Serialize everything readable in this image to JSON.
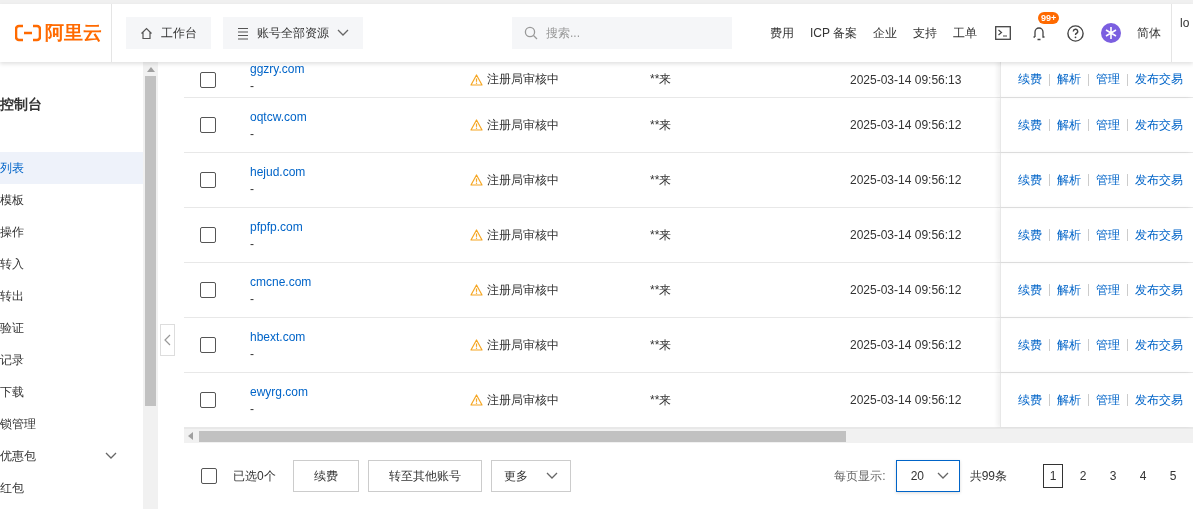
{
  "header": {
    "logo": "阿里云",
    "quick_buttons": [
      {
        "label": "工作台",
        "kind": "link"
      },
      {
        "label": "账号全部资源",
        "kind": "dropdown"
      }
    ],
    "search": {
      "placeholder": "搜索..."
    },
    "nav": [
      "费用",
      "ICP 备案",
      "企业",
      "支持",
      "工单"
    ],
    "notification_badge": "99+",
    "language": "简体",
    "user_cut": "lo"
  },
  "sidebar": {
    "title": "控制台",
    "items": [
      {
        "label": "列表",
        "selected": true,
        "kind": "link"
      },
      {
        "label": "模板",
        "selected": false,
        "kind": "link"
      },
      {
        "label": "操作",
        "selected": false,
        "kind": "link"
      },
      {
        "label": "转入",
        "selected": false,
        "kind": "link"
      },
      {
        "label": "转出",
        "selected": false,
        "kind": "link"
      },
      {
        "label": "验证",
        "selected": false,
        "kind": "link"
      },
      {
        "label": "记录",
        "selected": false,
        "kind": "link"
      },
      {
        "label": "下载",
        "selected": false,
        "kind": "link"
      },
      {
        "label": "锁管理",
        "selected": false,
        "kind": "link"
      },
      {
        "label": "优惠包",
        "selected": false,
        "kind": "group"
      },
      {
        "label": "红包",
        "selected": false,
        "kind": "link"
      }
    ]
  },
  "table": {
    "rows": [
      {
        "checked": false,
        "domain": "ggzry.com",
        "note": "-",
        "status": "注册局审核中",
        "owner": "**来",
        "date": "2025-03-14 09:56:13",
        "actions": [
          "续费",
          "解析",
          "管理",
          "发布交易"
        ]
      },
      {
        "checked": false,
        "domain": "oqtcw.com",
        "note": "-",
        "status": "注册局审核中",
        "owner": "**来",
        "date": "2025-03-14 09:56:12",
        "actions": [
          "续费",
          "解析",
          "管理",
          "发布交易"
        ]
      },
      {
        "checked": false,
        "domain": "hejud.com",
        "note": "-",
        "status": "注册局审核中",
        "owner": "**来",
        "date": "2025-03-14 09:56:12",
        "actions": [
          "续费",
          "解析",
          "管理",
          "发布交易"
        ]
      },
      {
        "checked": false,
        "domain": "pfpfp.com",
        "note": "-",
        "status": "注册局审核中",
        "owner": "**来",
        "date": "2025-03-14 09:56:12",
        "actions": [
          "续费",
          "解析",
          "管理",
          "发布交易"
        ]
      },
      {
        "checked": false,
        "domain": "cmcne.com",
        "note": "-",
        "status": "注册局审核中",
        "owner": "**来",
        "date": "2025-03-14 09:56:12",
        "actions": [
          "续费",
          "解析",
          "管理",
          "发布交易"
        ]
      },
      {
        "checked": false,
        "domain": "hbext.com",
        "note": "-",
        "status": "注册局审核中",
        "owner": "**来",
        "date": "2025-03-14 09:56:12",
        "actions": [
          "续费",
          "解析",
          "管理",
          "发布交易"
        ]
      },
      {
        "checked": false,
        "domain": "ewyrg.com",
        "note": "-",
        "status": "注册局审核中",
        "owner": "**来",
        "date": "2025-03-14 09:56:12",
        "actions": [
          "续费",
          "解析",
          "管理",
          "发布交易"
        ]
      }
    ]
  },
  "footer": {
    "select_all": {
      "checked": false
    },
    "selected_count": "已选0个",
    "buttons": [
      "续费",
      "转至其他账号"
    ],
    "more": "更多",
    "page_size_label": "每页显示:",
    "page_size": "20",
    "total": "共99条",
    "pages": [
      {
        "label": "1",
        "selected": true
      },
      {
        "label": "2",
        "selected": false
      },
      {
        "label": "3",
        "selected": false
      },
      {
        "label": "4",
        "selected": false
      },
      {
        "label": "5",
        "selected": false
      }
    ]
  }
}
